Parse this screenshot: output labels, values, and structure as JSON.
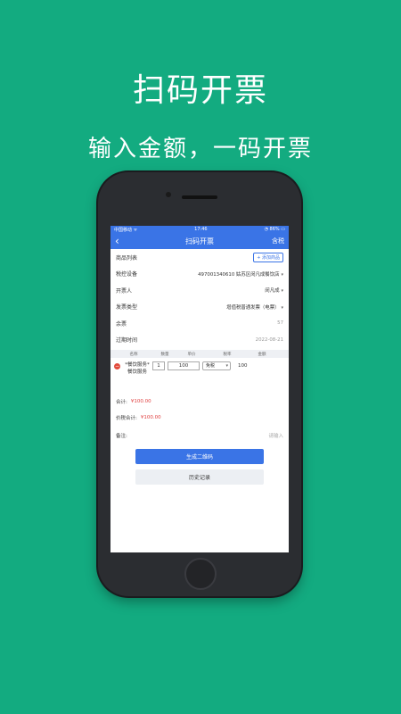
{
  "headline": "扫码开票",
  "subheadline": "输入金额，一码开票",
  "status": {
    "carrier": "中国移动 ᯤ",
    "time": "17:46",
    "battery": "◔ 86% ▭"
  },
  "nav": {
    "back": "‹",
    "title": "扫码开票",
    "right": "含税"
  },
  "form": {
    "goods_label": "商品列表",
    "add_goods": "+ 添加商品",
    "device_label": "税控设备",
    "device_value": "497001340610 姑苏区闵凡成餐饮店",
    "issuer_label": "开票人",
    "issuer_value": "闵凡成",
    "type_label": "发票类型",
    "type_value": "增值税普通发票（电票）",
    "remain_label": "余票",
    "remain_value": "57",
    "expire_label": "过期时间",
    "expire_value": "2022-08-21"
  },
  "table": {
    "headers": [
      "名称",
      "数量",
      "单价",
      "税率",
      "金额"
    ],
    "item": {
      "name": "*餐饮服务*餐饮服务",
      "qty": "1",
      "price": "100",
      "tax": "免税",
      "amount": "100"
    }
  },
  "totals": {
    "subtotal_label": "合计:",
    "subtotal_value": "¥100.00",
    "total_label": "价税合计:",
    "total_value": "¥100.00"
  },
  "remark": {
    "label": "备注:",
    "placeholder": "请输入"
  },
  "buttons": {
    "generate": "生成二维码",
    "history": "历史记录"
  },
  "colors": {
    "background": "#13ab80",
    "primary": "#3a74e6",
    "danger": "#e24a3b"
  }
}
